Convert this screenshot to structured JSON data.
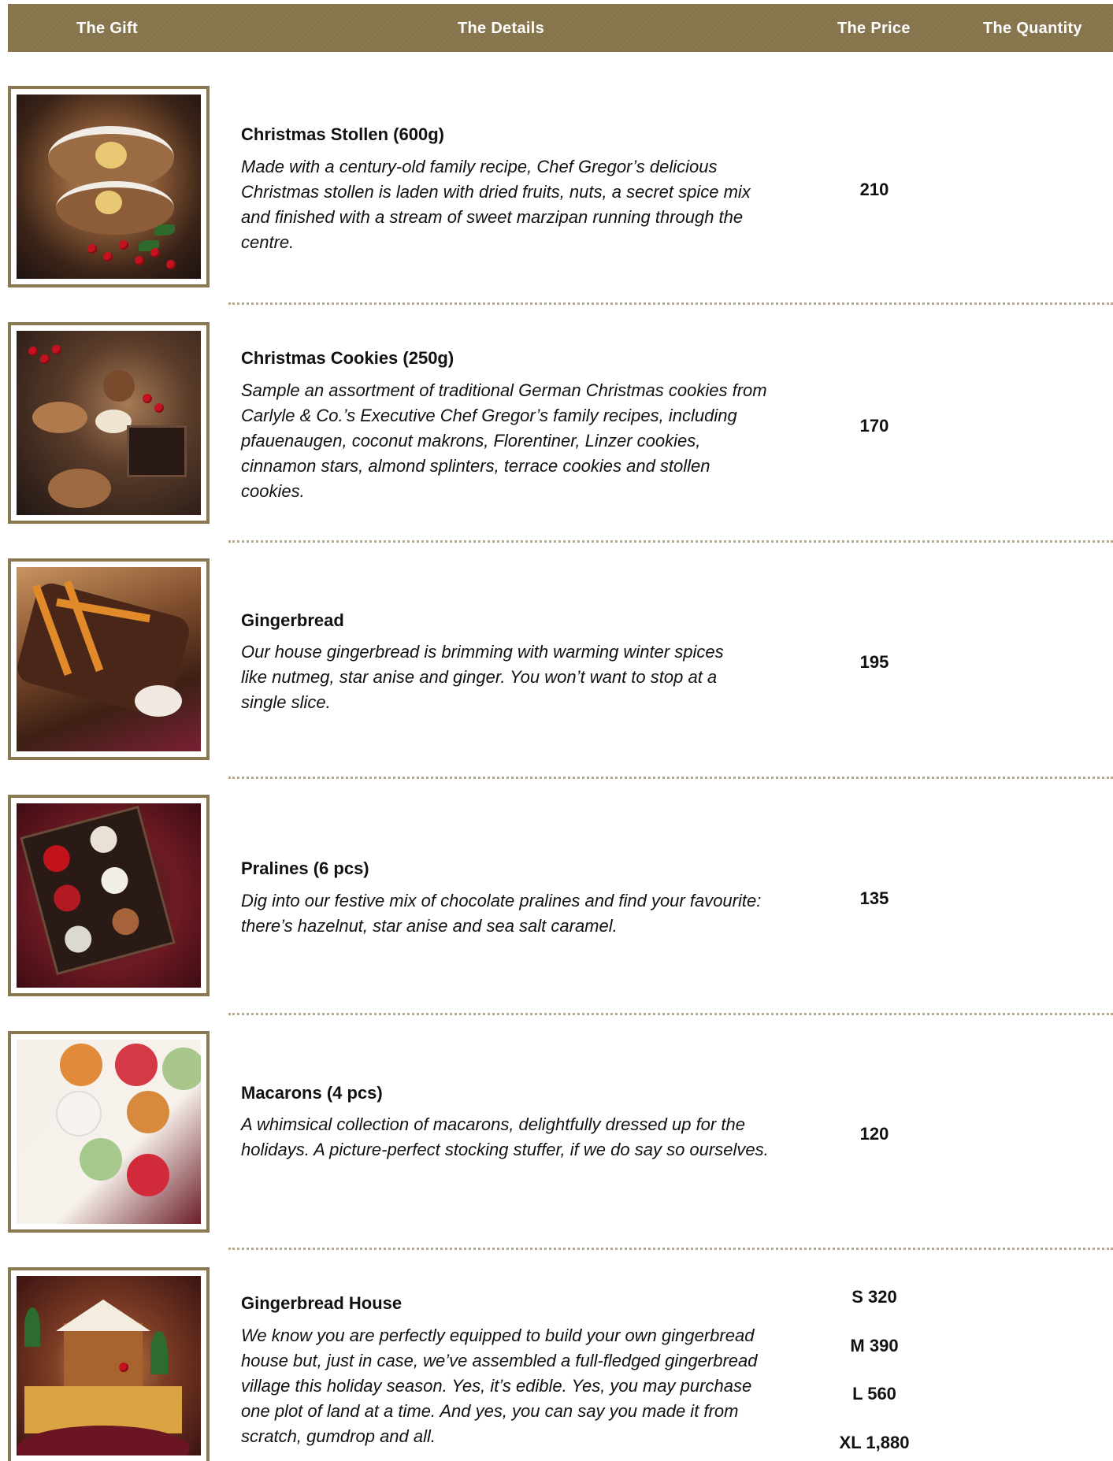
{
  "header": {
    "gift": "The Gift",
    "details": "The Details",
    "price": "The Price",
    "quantity": "The Quantity"
  },
  "items": [
    {
      "title": "Christmas Stollen (600g)",
      "description": "Made with a century-old family recipe, Chef Gregor’s delicious Christmas stollen is laden with dried fruits, nuts, a secret spice mix and finished with a stream of sweet marzipan running through the centre.",
      "price": "210"
    },
    {
      "title": "Christmas Cookies (250g)",
      "description": "Sample an assortment of traditional German Christmas cookies from Carlyle & Co.’s Executive Chef Gregor’s family recipes, including pfauenaugen, coconut makrons, Florentiner, Linzer cookies, cinnamon stars, almond splinters, terrace cookies and stollen cookies.",
      "price": "170"
    },
    {
      "title": "Gingerbread",
      "description": "Our house gingerbread is brimming with warming winter spices like nutmeg, star anise and ginger. You won’t want to stop at a single slice.",
      "price": "195"
    },
    {
      "title": "Pralines (6 pcs)",
      "description": "Dig into our festive mix of chocolate pralines and find your favourite: there’s hazelnut, star anise and sea salt caramel.",
      "price": "135"
    },
    {
      "title": "Macarons (4 pcs)",
      "description": "A whimsical collection of macarons, delightfully dressed up for the holidays. A picture-perfect stocking stuffer, if we do say so ourselves.",
      "price": "120"
    },
    {
      "title": "Gingerbread House",
      "description": "We know you are perfectly equipped to build your own gingerbread house but, just in case, we’ve assembled a full-fledged gingerbread village this holiday season. Yes, it’s edible. Yes, you may purchase one plot of land at a time. And yes, you can say you made it from scratch, gumdrop and all.",
      "prices": [
        "S 320",
        "M 390",
        "L 560",
        "XL 1,880"
      ]
    }
  ]
}
